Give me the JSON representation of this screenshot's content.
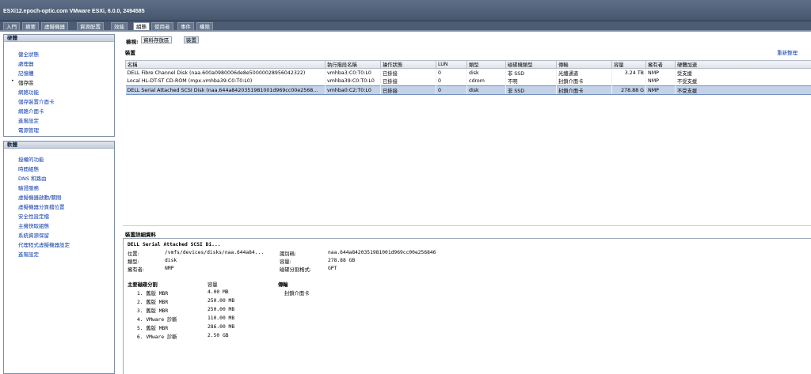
{
  "window": {
    "title": "ESXi12.epoch-optic.com VMware ESXi, 6.0.0, 2494585"
  },
  "tabs": [
    "入門",
    "摘要",
    "虛擬機器",
    "資源配置",
    "效能",
    "組態",
    "使用者",
    "事件",
    "權限"
  ],
  "hardware": {
    "header": "硬體",
    "items": [
      "健全狀態",
      "處理器",
      "記憶體",
      "儲存區",
      "網路功能",
      "儲存裝置介面卡",
      "網路介面卡",
      "進階設定",
      "電源管理"
    ],
    "current_index": 3
  },
  "software": {
    "header": "軟體",
    "items": [
      "授權的功能",
      "時間組態",
      "DNS 和路由",
      "驗證服務",
      "虛擬機器啟動/關閉",
      "虛擬機器分頁檔位置",
      "安全性設定檔",
      "主機快取組態",
      "系統資源保留",
      "代理程式虛擬機器設定",
      "進階設定"
    ]
  },
  "view": {
    "label": "檢視:",
    "buttons": [
      "資料存放區",
      "裝置"
    ],
    "selected": 1
  },
  "devices": {
    "heading": "裝置",
    "refresh": "重新整理",
    "columns": [
      "名稱",
      "執行階段名稱",
      "操作狀態",
      "LUN",
      "類型",
      "磁碟機類型",
      "傳輸",
      "容量",
      "擁有者",
      "硬體加速"
    ],
    "rows": [
      [
        "DELL Fibre Channel Disk (naa.600a0980006de8e50000028956042322)",
        "vmhba3:C0:T0:L0",
        "已掛接",
        "0",
        "disk",
        "非 SSD",
        "光纖通道",
        "3.24 TB",
        "NMP",
        "受支援"
      ],
      [
        "Local HL-DT-ST CD-ROM (mpx.vmhba39:C0:T0:L0)",
        "vmhba39:C0:T0:L0",
        "已掛接",
        "0",
        "cdrom",
        "不明",
        "封鎖介面卡",
        "",
        "NMP",
        "不受支援"
      ],
      [
        "DELL Serial Attached SCSI Disk (naa.644a8420351981001d969cc00e2568...",
        "vmhba0:C2:T0:L0",
        "已掛接",
        "0",
        "disk",
        "非 SSD",
        "封鎖介面卡",
        "278.88 G",
        "NMP",
        "不受支援"
      ]
    ],
    "selected_row": 2
  },
  "details": {
    "heading": "裝置詳細資料",
    "device_name": "DELL Serial Attached SCSI Di...",
    "location_label": "位置:",
    "location_value": "/vmfs/devices/disks/naa.644a84...",
    "type_label": "類型:",
    "type_value": "disk",
    "owner_label": "擁有者:",
    "owner_value": "NMP",
    "id_label": "識別碼:",
    "id_value": "naa.644a8420351981001d969cc00e256846",
    "capacity_label": "容量:",
    "capacity_value": "278.88 GB",
    "format_label": "磁碟分割格式:",
    "format_value": "GPT",
    "partitions_heading": "主要磁碟分割",
    "capacity_col_heading": "容量",
    "partitions": [
      {
        "name": "1. 舊版 MBR",
        "size": "4.00 MB"
      },
      {
        "name": "2. 舊版 MBR",
        "size": "250.00 MB"
      },
      {
        "name": "3. 舊版 MBR",
        "size": "250.00 MB"
      },
      {
        "name": "4. VMware 診斷",
        "size": "110.00 MB"
      },
      {
        "name": "5. 舊版 MBR",
        "size": "286.00 MB"
      },
      {
        "name": "6. VMware 診斷",
        "size": "2.50 GB"
      }
    ],
    "transport_heading": "傳輸",
    "transport_value": "封鎖介面卡"
  }
}
